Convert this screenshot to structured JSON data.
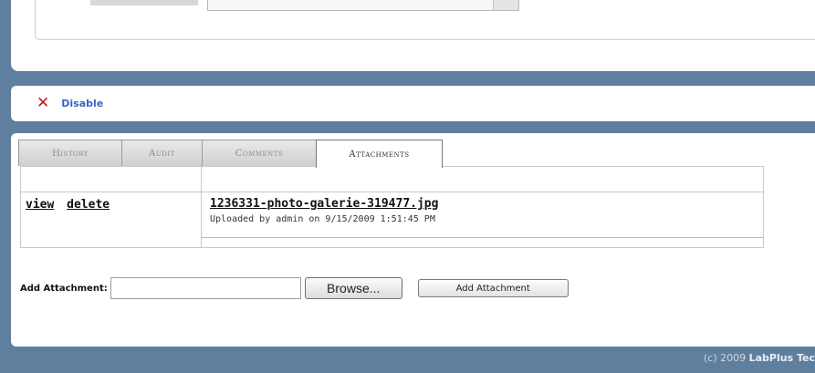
{
  "actions_bar": {
    "disable_icon": "close-x-icon",
    "disable_label": "Disable",
    "icon_color": "#c0141a",
    "link_color": "#3a62c9"
  },
  "tabs": [
    {
      "label": "History",
      "active": false
    },
    {
      "label": "Audit",
      "active": false
    },
    {
      "label": "Comments",
      "active": false
    },
    {
      "label": "Attachments",
      "active": true
    }
  ],
  "attachments": {
    "rows": [
      {
        "view_label": "view",
        "delete_label": "delete",
        "file_name": "1236331-photo-galerie-319477.jpg",
        "upload_info": "Uploaded by admin on 9/15/2009 1:51:45 PM"
      }
    ]
  },
  "add_attachment": {
    "label": "Add Attachment:",
    "file_value": "",
    "browse_label": "Browse...",
    "submit_label": "Add Attachment"
  },
  "footer": {
    "copyright": "(c) 2009 ",
    "brand": "LabPlus Tec"
  },
  "colors": {
    "frame": "#5f7f9e",
    "panel": "#ffffff"
  }
}
